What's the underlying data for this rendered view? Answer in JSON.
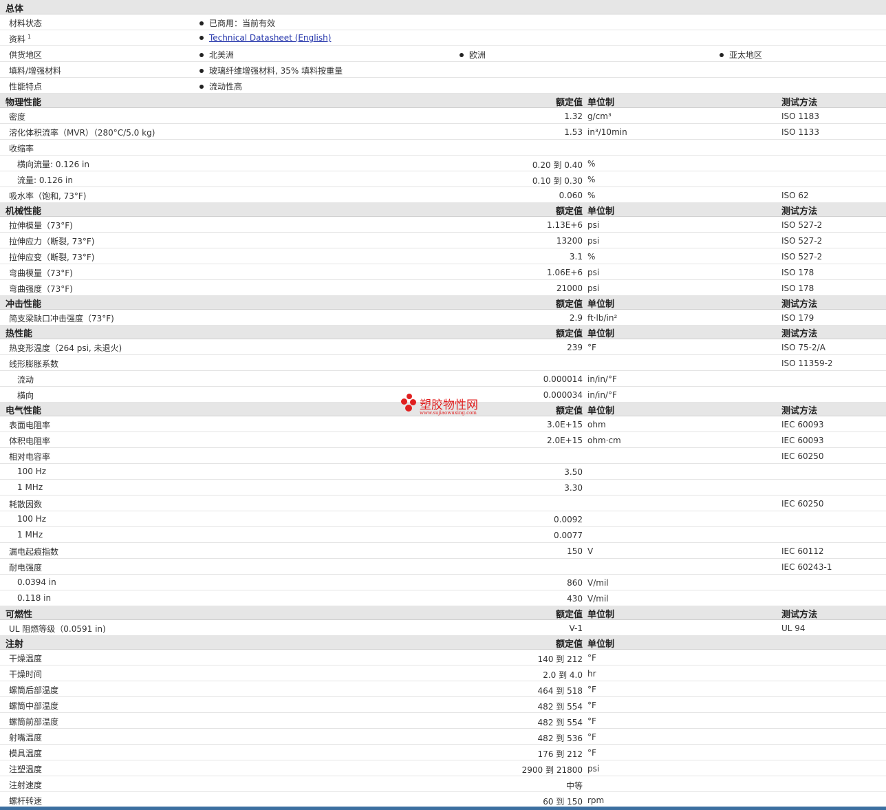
{
  "headers": {
    "value": "额定值",
    "unit": "单位制",
    "method": "测试方法"
  },
  "general": {
    "title": "总体",
    "status_label": "材料状态",
    "status_value": "已商用：当前有效",
    "docs_label": "资料",
    "docs_sup": "1",
    "docs_link": "Technical Datasheet (English)",
    "supply_label": "供货地区",
    "supply_regions": [
      "北美洲",
      "欧洲",
      "亚太地区"
    ],
    "filler_label": "填料/增强材料",
    "filler_value": "玻璃纤维增强材料, 35% 填料按重量",
    "features_label": "性能特点",
    "features_value": "流动性高"
  },
  "physical": {
    "title": "物理性能",
    "rows": [
      {
        "label": "密度",
        "value": "1.32",
        "unit": "g/cm³",
        "method": "ISO 1183"
      },
      {
        "label": "溶化体积流率（MVR）（280°C/5.0 kg)",
        "value": "1.53",
        "unit": "in³/10min",
        "method": "ISO 1133"
      },
      {
        "label": "收缩率",
        "value": "",
        "unit": "",
        "method": ""
      },
      {
        "label": "横向流量: 0.126 in",
        "value": "0.20 到 0.40",
        "unit": "%",
        "method": ""
      },
      {
        "label": "流量: 0.126 in",
        "value": "0.10 到 0.30",
        "unit": "%",
        "method": ""
      },
      {
        "label": "吸水率（饱和, 73°F)",
        "value": "0.060",
        "unit": "%",
        "method": "ISO 62"
      }
    ]
  },
  "mechanical": {
    "title": "机械性能",
    "rows": [
      {
        "label": "拉伸模量（73°F)",
        "value": "1.13E+6",
        "unit": "psi",
        "method": "ISO 527-2"
      },
      {
        "label": "拉伸应力（断裂, 73°F)",
        "value": "13200",
        "unit": "psi",
        "method": "ISO 527-2"
      },
      {
        "label": "拉伸应变（断裂, 73°F)",
        "value": "3.1",
        "unit": "%",
        "method": "ISO 527-2"
      },
      {
        "label": "弯曲模量（73°F)",
        "value": "1.06E+6",
        "unit": "psi",
        "method": "ISO 178"
      },
      {
        "label": "弯曲强度（73°F)",
        "value": "21000",
        "unit": "psi",
        "method": "ISO 178"
      }
    ]
  },
  "impact": {
    "title": "冲击性能",
    "rows": [
      {
        "label": "简支梁缺口冲击强度（73°F)",
        "value": "2.9",
        "unit": "ft·lb/in²",
        "method": "ISO 179"
      }
    ]
  },
  "thermal": {
    "title": "热性能",
    "rows": [
      {
        "label": "热变形温度（264 psi, 未退火)",
        "value": "239",
        "unit": "°F",
        "method": "ISO 75-2/A"
      },
      {
        "label": "线形膨胀系数",
        "value": "",
        "unit": "",
        "method": "ISO 11359-2"
      },
      {
        "label": "流动",
        "value": "0.000014",
        "unit": "in/in/°F",
        "method": ""
      },
      {
        "label": "横向",
        "value": "0.000034",
        "unit": "in/in/°F",
        "method": ""
      }
    ]
  },
  "electrical": {
    "title": "电气性能",
    "rows": [
      {
        "label": "表面电阻率",
        "value": "3.0E+15",
        "unit": "ohm",
        "method": "IEC 60093"
      },
      {
        "label": "体积电阻率",
        "value": "2.0E+15",
        "unit": "ohm·cm",
        "method": "IEC 60093"
      },
      {
        "label": "相对电容率",
        "value": "",
        "unit": "",
        "method": "IEC 60250"
      },
      {
        "label": "100 Hz",
        "value": "3.50",
        "unit": "",
        "method": ""
      },
      {
        "label": "1 MHz",
        "value": "3.30",
        "unit": "",
        "method": ""
      },
      {
        "label": "耗散因数",
        "value": "",
        "unit": "",
        "method": "IEC 60250"
      },
      {
        "label": "100 Hz",
        "value": "0.0092",
        "unit": "",
        "method": ""
      },
      {
        "label": "1 MHz",
        "value": "0.0077",
        "unit": "",
        "method": ""
      },
      {
        "label": "漏电起痕指数",
        "value": "150",
        "unit": "V",
        "method": "IEC 60112"
      },
      {
        "label": "耐电强度",
        "value": "",
        "unit": "",
        "method": "IEC 60243-1"
      },
      {
        "label": "0.0394 in",
        "value": "860",
        "unit": "V/mil",
        "method": ""
      },
      {
        "label": "0.118 in",
        "value": "430",
        "unit": "V/mil",
        "method": ""
      }
    ]
  },
  "flammability": {
    "title": "可燃性",
    "rows": [
      {
        "label": "UL 阻燃等级（0.0591 in)",
        "value": "V-1",
        "unit": "",
        "method": "UL 94"
      }
    ]
  },
  "injection": {
    "title": "注射",
    "rows": [
      {
        "label": "干燥温度",
        "value": "140 到 212",
        "unit": "°F"
      },
      {
        "label": "干燥时间",
        "value": "2.0 到 4.0",
        "unit": "hr"
      },
      {
        "label": "螺筒后部温度",
        "value": "464 到 518",
        "unit": "°F"
      },
      {
        "label": "螺筒中部温度",
        "value": "482 到 554",
        "unit": "°F"
      },
      {
        "label": "螺筒前部温度",
        "value": "482 到 554",
        "unit": "°F"
      },
      {
        "label": "射嘴温度",
        "value": "482 到 536",
        "unit": "°F"
      },
      {
        "label": "模具温度",
        "value": "176 到 212",
        "unit": "°F"
      },
      {
        "label": "注塑温度",
        "value": "2900 到 21800",
        "unit": "psi"
      },
      {
        "label": "注射速度",
        "value": "中等",
        "unit": ""
      },
      {
        "label": "螺杆转速",
        "value": "60 到 150",
        "unit": "rpm"
      }
    ]
  },
  "watermark": {
    "text": "塑胶物性网",
    "url": "www.sujiaowuxing.com"
  }
}
